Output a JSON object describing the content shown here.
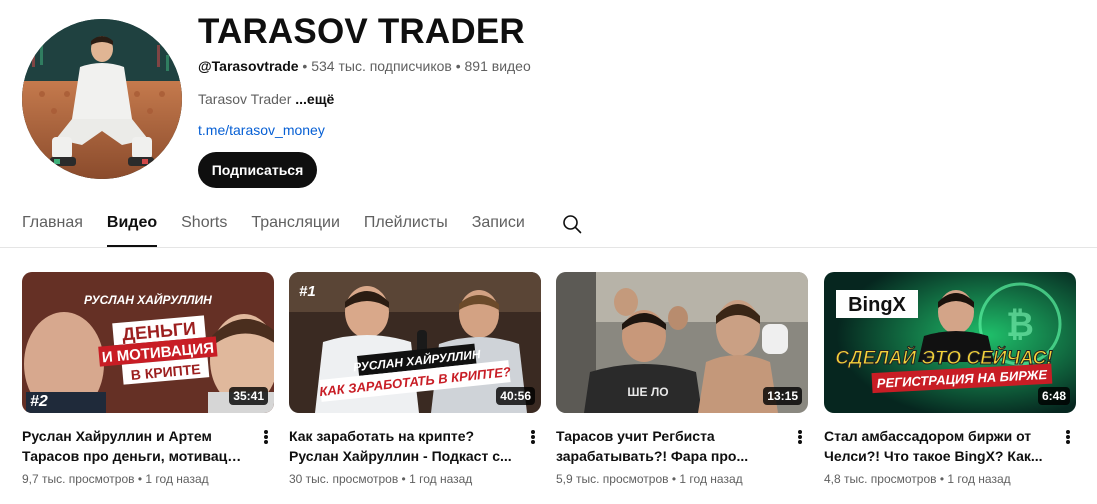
{
  "channel": {
    "name": "TARASOV TRADER",
    "handle": "@Tarasovtrade",
    "stats": " • 534 тыс. подписчиков • 891 видео",
    "description": "Tarasov Trader ",
    "more_label": "...ещё",
    "link": "t.me/tarasov_money",
    "subscribe_label": "Подписаться"
  },
  "tabs": [
    {
      "label": "Главная",
      "active": false
    },
    {
      "label": "Видео",
      "active": true
    },
    {
      "label": "Shorts",
      "active": false
    },
    {
      "label": "Трансляции",
      "active": false
    },
    {
      "label": "Плейлисты",
      "active": false
    },
    {
      "label": "Записи",
      "active": false
    }
  ],
  "videos": [
    {
      "title": "Руслан Хайруллин и Артем Тарасов про деньги, мотивацию ...",
      "views": "9,7 тыс. просмотров",
      "age": "1 год назад",
      "duration": "35:41",
      "thumb_text": {
        "top": "РУСЛАН ХАЙРУЛЛИН",
        "line1": "ДЕНЬГИ",
        "line2": "И МОТИВАЦИЯ",
        "line3": "В КРИПТЕ",
        "corner": "#2"
      }
    },
    {
      "title": "Как заработать на крипте? Руслан Хайруллин - Подкаст с...",
      "views": "30 тыс. просмотров",
      "age": "1 год назад",
      "duration": "40:56",
      "thumb_text": {
        "corner": "#1",
        "banner1": "РУСЛАН ХАЙРУЛЛИН",
        "banner2": "КАК ЗАРАБОТАТЬ В КРИПТЕ?"
      }
    },
    {
      "title": "Тарасов учит Регбиста зарабатывать?! Фара про...",
      "views": "5,9 тыс. просмотров",
      "age": "1 год назад",
      "duration": "13:15",
      "thumb_text": {
        "shirt": "ШЕ ЛО"
      }
    },
    {
      "title": "Стал амбассадором биржи от Челси?! Что такое BingX? Как...",
      "views": "4,8 тыс. просмотров",
      "age": "1 год назад",
      "duration": "6:48",
      "thumb_text": {
        "logo": "BingX",
        "headline": "СДЕЛАЙ ЭТО СЕЙЧАС!",
        "sub": "РЕГИСТРАЦИЯ НА БИРЖЕ"
      }
    }
  ],
  "colors": {
    "subscribe_bg": "#0f0f0f",
    "link": "#065fd4",
    "meta": "#606060"
  }
}
